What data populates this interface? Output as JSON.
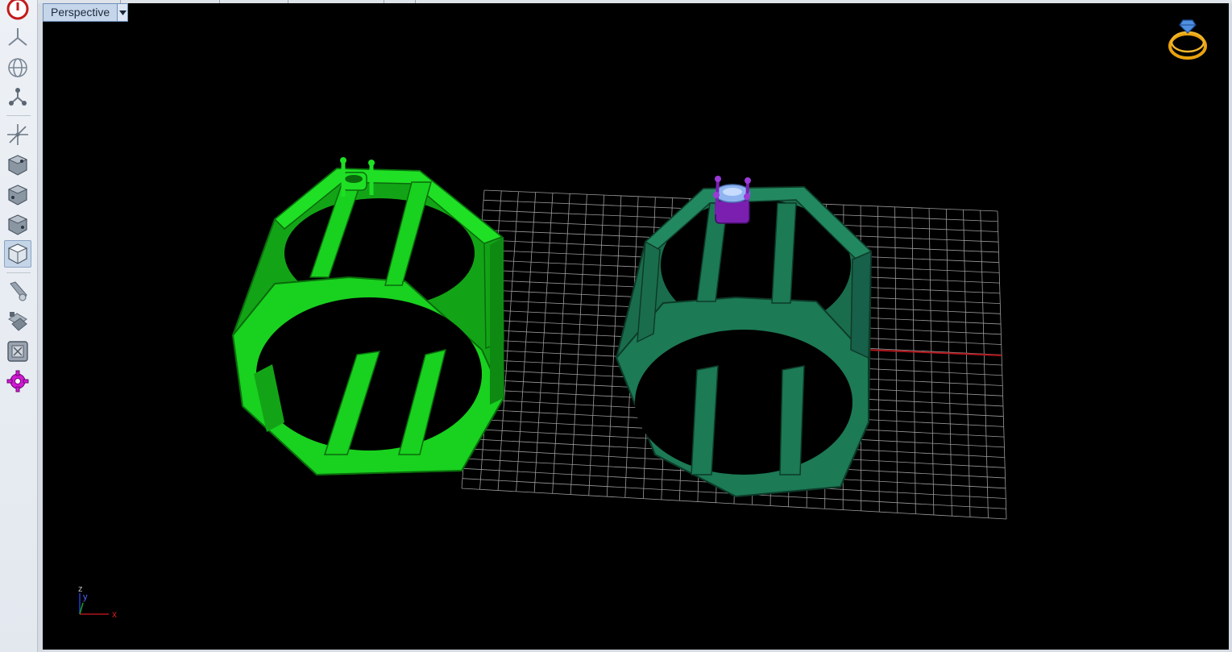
{
  "viewport": {
    "name": "Perspective",
    "dropdown_icon": "triangle-down-icon"
  },
  "toolbar": {
    "tools": [
      {
        "name": "power-button",
        "icon": "power-icon",
        "color": "#d11a1a"
      },
      {
        "name": "view-top-button",
        "icon": "tripod-icon"
      },
      {
        "name": "view-globe-button",
        "icon": "globe-icon"
      },
      {
        "name": "view-nodes-button",
        "icon": "nodes-icon"
      },
      {
        "name": "move-axis-button",
        "icon": "move-axes-icon"
      },
      {
        "name": "cube-view-1-button",
        "icon": "cube-icon"
      },
      {
        "name": "cube-view-2-button",
        "icon": "cube-icon"
      },
      {
        "name": "cube-view-3-button",
        "icon": "cube-icon"
      },
      {
        "name": "cube-view-4-button",
        "icon": "cube-icon",
        "active": true
      },
      {
        "name": "render-tool-button",
        "icon": "pencil-render-icon"
      },
      {
        "name": "material-tool-button",
        "icon": "layers-icon"
      },
      {
        "name": "fit-view-button",
        "icon": "fit-view-icon"
      },
      {
        "name": "settings-button",
        "icon": "gear-icon",
        "color": "#d11ad6"
      }
    ]
  },
  "axis_labels": {
    "x": "x",
    "y": "y",
    "z": "z"
  },
  "colors": {
    "ring_left": "#19d11f",
    "ring_right": "#1c7a55",
    "gem": "#8fb4f0",
    "prongs": "#7a1fb0",
    "grid": "#9a9a9a",
    "axis_x": "#b0161c",
    "axis_z": "#1e3fd1",
    "badge": "#e8a20f"
  },
  "badge_icon": "ring-icon"
}
